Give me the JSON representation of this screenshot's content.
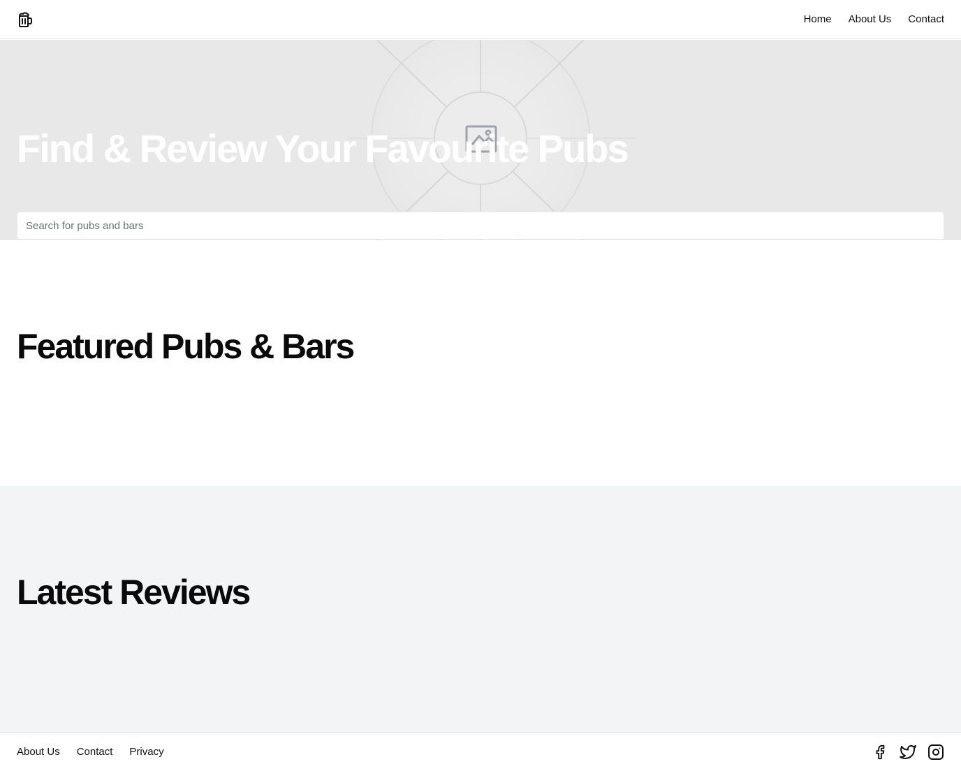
{
  "header": {
    "logo_icon": "beer-mug-icon",
    "nav": [
      {
        "label": "Home"
      },
      {
        "label": "About Us"
      },
      {
        "label": "Contact"
      }
    ]
  },
  "hero": {
    "title": "Find & Review Your Favourite Pubs",
    "background_icon": "image-placeholder-icon",
    "search": {
      "placeholder": "Search for pubs and bars",
      "value": ""
    }
  },
  "featured": {
    "title": "Featured Pubs & Bars"
  },
  "latest": {
    "title": "Latest Reviews"
  },
  "footer": {
    "links": [
      {
        "label": "About Us"
      },
      {
        "label": "Contact"
      },
      {
        "label": "Privacy"
      }
    ],
    "socials": [
      {
        "icon": "facebook-icon"
      },
      {
        "icon": "twitter-icon"
      },
      {
        "icon": "instagram-icon"
      }
    ]
  },
  "colors": {
    "hero_bg": "#e8e8e8",
    "reviews_bg": "#f3f4f6",
    "text": "#0a0a0a",
    "hero_text": "#ffffff"
  }
}
